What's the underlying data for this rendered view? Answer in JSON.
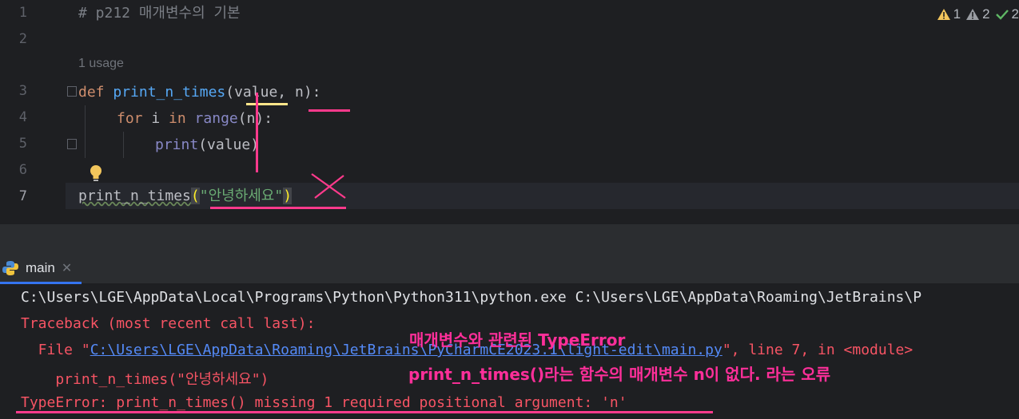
{
  "editor": {
    "line_numbers": [
      "1",
      "2",
      "3",
      "4",
      "5",
      "6",
      "7"
    ],
    "comment": "# p212 매개변수의 기본",
    "usage_hint": "1 usage",
    "code": {
      "def_kw": "def",
      "func_name": "print_n_times",
      "params_open": "(",
      "param_value": "value",
      "param_sep": ", ",
      "param_n": "n",
      "params_close": "):",
      "for_kw": "for",
      "for_var": " i ",
      "in_kw": "in",
      "range_fn": " range",
      "range_args": "(n):",
      "print_fn": "print",
      "print_args": "(value)",
      "call_name": "print_n_times",
      "call_open": "(",
      "call_str": "\"안녕하세요\"",
      "call_close": ")"
    },
    "inspections": {
      "warnings": "1",
      "weak_warnings": "2",
      "typos": "2"
    }
  },
  "run_panel": {
    "tab_label": "main",
    "close_glyph": "✕",
    "console": {
      "cmd": "C:\\Users\\LGE\\AppData\\Local\\Programs\\Python\\Python311\\python.exe C:\\Users\\LGE\\AppData\\Roaming\\JetBrains\\P",
      "traceback": "Traceback (most recent call last):",
      "file_prefix": "  File \"",
      "file_link": "C:\\Users\\LGE\\AppData\\Roaming\\JetBrains\\PyCharmCE2023.1\\light-edit\\main.py",
      "file_suffix": "\", line 7, in <module>",
      "code_line": "    print_n_times(\"안녕하세요\")",
      "error": "TypeError: print_n_times() missing 1 required positional argument: 'n'"
    }
  },
  "annotations": {
    "title": "매개변수와 관련된 TypeError",
    "explain": "print_n_times()라는 함수의 매개변수 n이 없다. 라는 오류"
  },
  "colors": {
    "annotation": "#ff2f9a",
    "error": "#f75464",
    "link": "#548af7"
  }
}
